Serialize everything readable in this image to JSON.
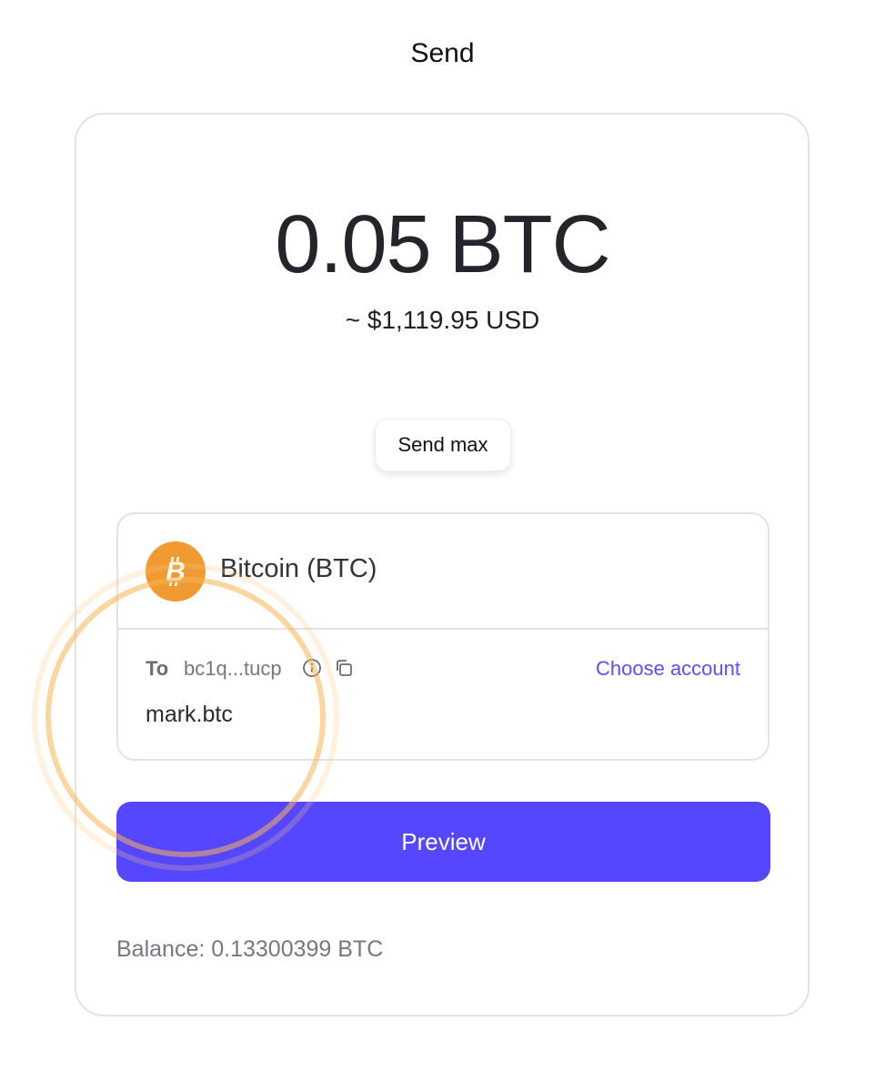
{
  "header": {
    "title": "Send"
  },
  "amount": {
    "value": "0.05",
    "unit": "BTC",
    "fiat": "~ $1,119.95 USD"
  },
  "send_max_label": "Send max",
  "asset": {
    "name": "Bitcoin (BTC)",
    "icon": "bitcoin-icon",
    "color": "#f09a32"
  },
  "recipient": {
    "to_label": "To",
    "address": "bc1q...tucp",
    "name": "mark.btc",
    "choose_account_label": "Choose account"
  },
  "preview_label": "Preview",
  "balance": "Balance: 0.13300399 BTC",
  "colors": {
    "accent": "#5546ff",
    "link": "#5b4ff2",
    "btc": "#f09a32",
    "highlight_ring": "#fbc877"
  }
}
